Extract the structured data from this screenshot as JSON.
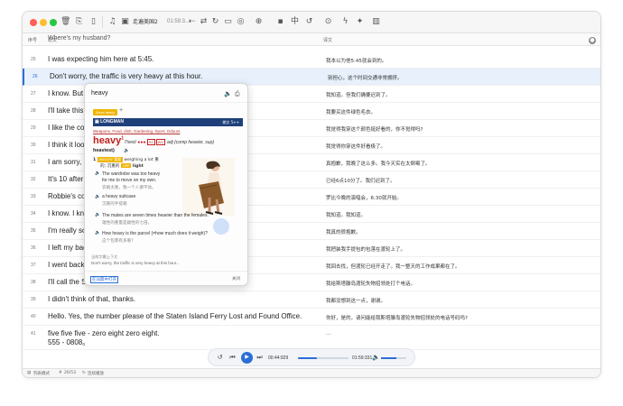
{
  "toolbar": {
    "track_title": "走遍美国2",
    "track_time": "01:59:3...",
    "icons": [
      "trash-icon",
      "copy-icon",
      "phone-icon",
      "music-icon",
      "prev-icon",
      "next-icon",
      "loop-icon",
      "speed-icon",
      "target-icon",
      "subtitle-icon",
      "zh-icon",
      "replay-icon",
      "eye-icon",
      "bolt-icon",
      "star-icon",
      "sidebar-icon"
    ]
  },
  "columns": {
    "num": "序号",
    "original": "原文",
    "translation": "译文"
  },
  "partial_top_line": "Where's my husband?",
  "rows": [
    {
      "num": "25",
      "en": "I was expecting him here at 5:45.",
      "zh": "我本以为他5:45就会到的。"
    },
    {
      "num": "26",
      "en": "Don't worry, the traffic is very heavy at this hour.",
      "zh": "别担心，这个时间交通非常拥挤。"
    },
    {
      "num": "27",
      "en": "I know. But wh",
      "zh": "我知道。但我们确要迟到了。"
    },
    {
      "num": "28",
      "en": "I'll take this g",
      "zh": "我要买这件绿色毛衣。"
    },
    {
      "num": "29",
      "en": "I like the colo",
      "zh": "我觉得我穿这个颜色挺好看的，你不觉得吗?"
    },
    {
      "num": "30",
      "en": "I think it look",
      "zh": "我觉得你穿这件好看极了。"
    },
    {
      "num": "31",
      "en": "I am sorry, I'v",
      "zh": "真抱歉，我晚了这么多。我今天实在太倒霉了。"
    },
    {
      "num": "32",
      "en": "It's 10 after 6",
      "zh": "已经6点10分了。我们迟到了。"
    },
    {
      "num": "33",
      "en": "Robbie's con",
      "zh": "罗比今晚的演唱会，6:30就开始。"
    },
    {
      "num": "34",
      "en": "I know. I kno",
      "zh": "我知道。我知道。"
    },
    {
      "num": "35",
      "en": "I'm really sor",
      "zh": "我真的很抱歉。"
    },
    {
      "num": "36",
      "en": "I left my bag",
      "zh": "我把装我手提包的包落在渡轮上了。"
    },
    {
      "num": "37",
      "en": "I went back f",
      "zh": "我回去找，但渡轮已经开走了。我一整天的工作成果都在了。"
    },
    {
      "num": "38",
      "en": "I'll call the St",
      "zh": "我给斯塔滕岛渡轮失物招领处打个电话。"
    },
    {
      "num": "39",
      "en": "I didn't think of that, thanks.",
      "zh": "我都没想到这一点，谢谢。"
    },
    {
      "num": "40",
      "en": "Hello. Yes, the number please of the Staten Island Ferry Lost and Found Office.",
      "zh": "你好，是的，请问能给我斯塔滕岛渡轮失物招领处的电话号码吗?"
    },
    {
      "num": "41",
      "en": "five five five - zero eight zero eight.",
      "en2": "555 - 0808。",
      "zh": "..."
    }
  ],
  "selected_row": "26",
  "player": {
    "current_time": "00:44:929",
    "total_time": "01:59:331",
    "progress": 0.37,
    "volume": 0.6
  },
  "statusbar": {
    "mode": "列表模式",
    "hash": "#",
    "position": "26/53",
    "loop": "连续播放"
  },
  "popup": {
    "word": "heavy",
    "word_family_label": "Word family",
    "dict_name": "LONGMAN",
    "dict_edition": "朗文 5++",
    "topics": "Weapons, Food, dish, Gardening, Sport, Odours",
    "headword": "heavy",
    "headword_sup": "1",
    "pron": "/'hevi/",
    "stars": "●●●",
    "tag_s1": "S1",
    "tag_w1": "W1",
    "pos": "adj",
    "comp": "(comp heavier, sup)",
    "heaviest": "heaviest)",
    "sense_num": "1",
    "sense_badge": "WEIGHT 重量",
    "sense_def": "weighing a lot 重",
    "sense_zh": "的; 沉重的",
    "opp_badge": "OPP",
    "opp_word": "light",
    "ex1_en": "The wardrobe was too heavy",
    "ex1_en2": "for me to move on my own.",
    "ex1_zh": "衣橱太重，我一个人挪不动。",
    "ex2_en": "a heavy suitcase",
    "ex2_zh": "沉重的手提箱",
    "ex3_en": "The mates are seven times heavier than the females.",
    "ex3_zh": "雄性的重量是雌性的七倍。",
    "ex4_en": "How heavy is the parcel (=how much does it weigh)?",
    "ex4_zh": "这个包裹有多重?",
    "current_ctx_label": "当前字幕上下文",
    "current_sentence": "Don't worry, the traffic is very heavy at this hour...",
    "open_in_dict": "在词典中打开",
    "close": "关闭"
  },
  "colors": {
    "accent": "#2b6fd6",
    "longman_bar": "#1f3f7a",
    "headword_red": "#c51f1f",
    "badge_yellow": "#f0b400",
    "selected_row_bg": "#e7f0fb"
  }
}
